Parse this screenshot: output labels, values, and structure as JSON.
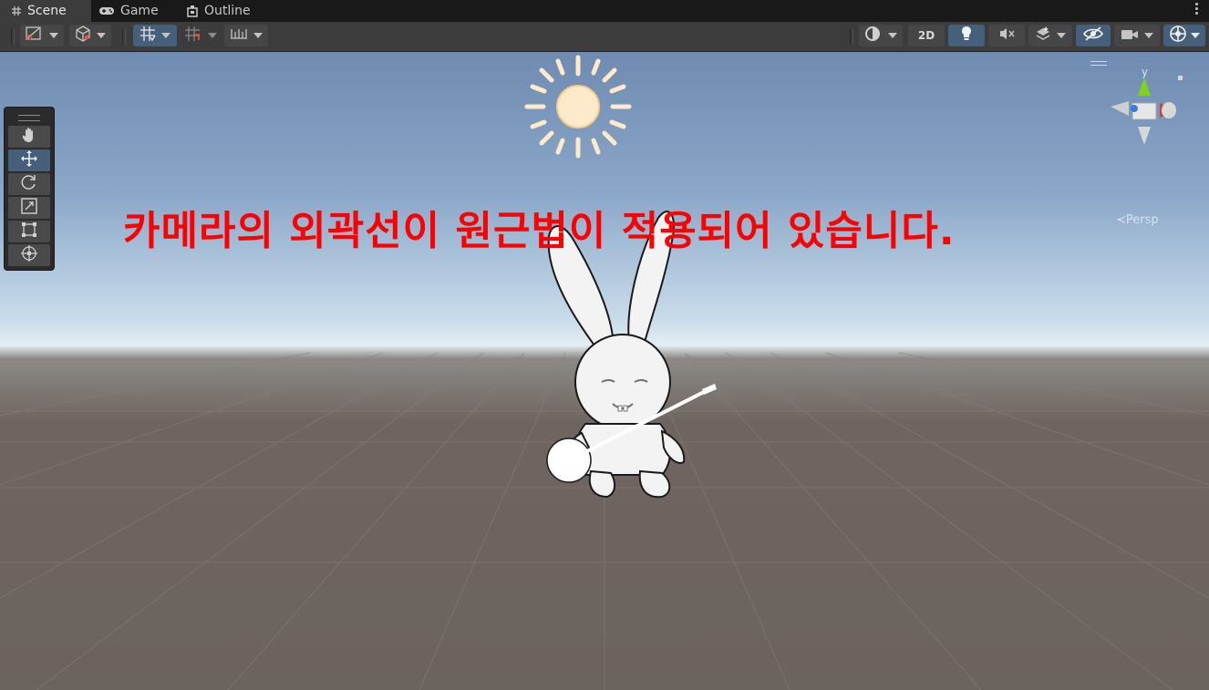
{
  "tabs": [
    {
      "label": "Scene",
      "icon": "grid-hash-icon",
      "active": true
    },
    {
      "label": "Game",
      "icon": "gamepad-icon",
      "active": false
    },
    {
      "label": "Outline",
      "icon": "outline-icon",
      "active": false
    }
  ],
  "toolbar": {
    "mode_2d_label": "2D",
    "left_tools": [
      "draw-mode-icon",
      "shading-cube-icon",
      "grid-snap-icon",
      "increment-snap-icon",
      "ruler-icon"
    ],
    "right_tools": [
      "render-mode-icon",
      "lighting-icon",
      "audio-mute-icon",
      "effects-layers-icon",
      "hidden-objects-icon",
      "camera-icon",
      "gizmos-icon"
    ]
  },
  "scene_tools": [
    "hand-icon",
    "move-icon",
    "rotate-icon",
    "scale-icon",
    "rect-transform-icon",
    "transform-icon"
  ],
  "overlay": {
    "text": "카메라의 외곽선이 원근법이 적용되어 있습니다."
  },
  "gizmo": {
    "axis_label": "y",
    "projection_label": "Persp"
  },
  "colors": {
    "overlay_text": "#ff0000",
    "active_toggle": "#46607c",
    "gizmo_y": "#7ed321",
    "gizmo_x": "#d0413b",
    "gizmo_z": "#3a7dd8"
  }
}
